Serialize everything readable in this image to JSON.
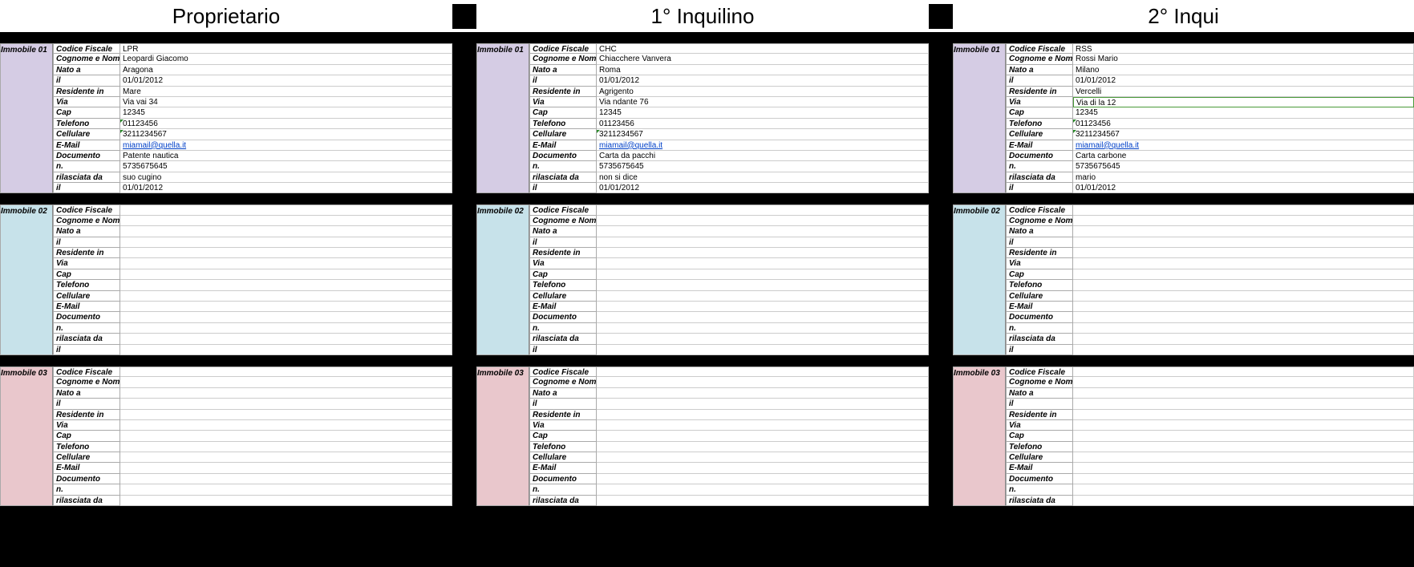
{
  "headers": [
    "Proprietario",
    "1° Inquilino",
    "2° Inqui"
  ],
  "fieldLabels": [
    "Codice Fiscale",
    "Cognome e Nome",
    "Nato a",
    "il",
    "Residente in",
    "Via",
    "Cap",
    "Telefono",
    "Cellulare",
    "E-Mail",
    "Documento",
    "n.",
    "rilasciata da",
    "il"
  ],
  "immobileLabels": [
    "Immobile 01",
    "Immobile 02",
    "Immobile 03"
  ],
  "blockColors": [
    "purple",
    "blue",
    "pink"
  ],
  "sections": [
    {
      "blocks": [
        {
          "vals": [
            "LPR",
            "Leopardi Giacomo",
            "Aragona",
            "01/01/2012",
            "Mare",
            "Via vai 34",
            "12345",
            "01123456",
            "3211234567",
            "miamail@quella.it",
            "Patente nautica",
            "5735675645",
            "suo cugino",
            "01/01/2012"
          ],
          "emailIdx": 9,
          "triIdx": [
            7,
            8
          ]
        },
        {
          "vals": [
            "",
            "",
            "",
            "",
            "",
            "",
            "",
            "",
            "",
            "",
            "",
            "",
            "",
            ""
          ]
        },
        {
          "vals": [
            "",
            "",
            "",
            "",
            "",
            "",
            "",
            "",
            "",
            "",
            "",
            "",
            ""
          ],
          "count": 13
        }
      ]
    },
    {
      "blocks": [
        {
          "vals": [
            "CHC",
            "Chiacchere Vanvera",
            "Roma",
            "01/01/2012",
            "Agrigento",
            "Via ndante 76",
            "12345",
            "01123456",
            "3211234567",
            "miamail@quella.it",
            "Carta da pacchi",
            "5735675645",
            "non si dice",
            "01/01/2012"
          ],
          "emailIdx": 9,
          "triIdx": [
            8
          ]
        },
        {
          "vals": [
            "",
            "",
            "",
            "",
            "",
            "",
            "",
            "",
            "",
            "",
            "",
            "",
            "",
            ""
          ]
        },
        {
          "vals": [
            "",
            "",
            "",
            "",
            "",
            "",
            "",
            "",
            "",
            "",
            "",
            "",
            ""
          ],
          "count": 13
        }
      ]
    },
    {
      "blocks": [
        {
          "vals": [
            "RSS",
            "Rossi Mario",
            "Milano",
            "01/01/2012",
            "Vercelli",
            "Via di la 12",
            "12345",
            "01123456",
            "3211234567",
            "miamail@quella.it",
            "Carta carbone",
            "5735675645",
            "mario",
            "01/01/2012"
          ],
          "emailIdx": 9,
          "triIdx": [
            7,
            8
          ],
          "greenIdx": 5
        },
        {
          "vals": [
            "",
            "",
            "",
            "",
            "",
            "",
            "",
            "",
            "",
            "",
            "",
            "",
            "",
            ""
          ]
        },
        {
          "vals": [
            "",
            "",
            "",
            "",
            "",
            "",
            "",
            "",
            "",
            "",
            "",
            "",
            ""
          ],
          "count": 13
        }
      ]
    }
  ]
}
